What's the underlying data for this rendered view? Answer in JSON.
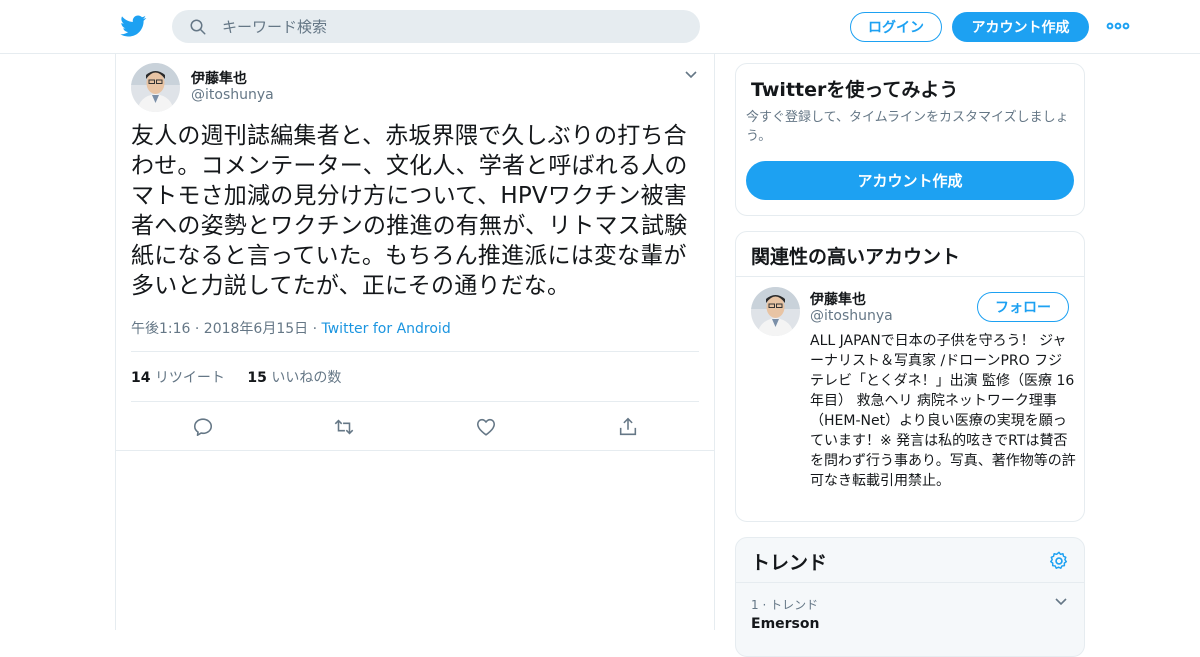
{
  "header": {
    "search_placeholder": "キーワード検索",
    "login_label": "ログイン",
    "signup_label": "アカウント作成",
    "brand_color": "#1da1f2"
  },
  "tweet": {
    "author_name": "伊藤隼也",
    "author_handle": "@itoshunya",
    "text": "友人の週刊誌編集者と、赤坂界隈で久しぶりの打ち合わせ。コメンテーター、文化人、学者と呼ばれる人のマトモさ加減の見分け方について、HPVワクチン被害者への姿勢とワクチンの推進の有無が、リトマス試験紙になると言っていた。もちろん推進派には変な輩が多いと力説してたが、正にその通りだな。",
    "time": "午後1:16 · 2018年6月15日 · ",
    "source": "Twitter for Android",
    "retweets_count": "14",
    "retweets_label": "リツイート",
    "likes_count": "15",
    "likes_label": "いいねの数"
  },
  "sidebar": {
    "signup_card": {
      "title": "Twitterを使ってみよう",
      "subtitle": "今すぐ登録して、タイムラインをカスタマイズしましょう。",
      "button_label": "アカウント作成"
    },
    "related_card": {
      "title": "関連性の高いアカウント",
      "account_name": "伊藤隼也",
      "account_handle": "@itoshunya",
      "follow_label": "フォロー",
      "bio": "ALL JAPANで日本の子供を守ろう！ ジャーナリスト＆写真家 /ドローンPRO フジテレビ「とくダネ！」出演 監修（医療 16年目） 救急ヘリ 病院ネットワーク理事（HEM-Net）より良い医療の実現を願っています！※ 発言は私的呟きでRTは賛否を問わず行う事あり。写真、著作物等の許可なき転載引用禁止。"
    },
    "trends_card": {
      "title": "トレンド",
      "items": [
        {
          "rank": "1 · トレンド",
          "name": "Emerson"
        }
      ]
    }
  }
}
